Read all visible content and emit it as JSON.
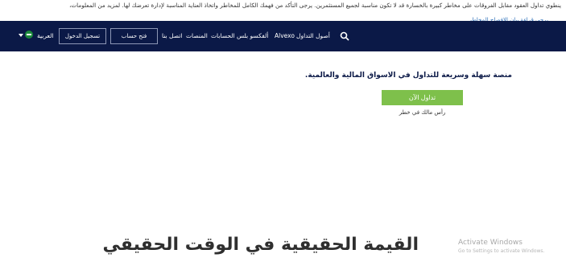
{
  "risk_banner": {
    "text": "ينطوي تداول العقود مقابل الفروقات على مخاطر كبيرة بالخسارة قد لا تكون مناسبة لجميع المستثمرين. يرجى التأكد من فهمك الكامل للمخاطر واتخاذ العناية المناسبة لإدارة تعرضك لها. لمزيد من المعلومات،",
    "link": "يرجى قراءة بيان الإفصاح المخاطر"
  },
  "navbar": {
    "items": {
      "trading_assets": "أصول التداول",
      "alvexo": "Alvexo",
      "alvexo_plus": "ألفكسو بلس",
      "accounts": "الحسابات",
      "platforms": "المنصات",
      "contact": "اتصل بنا"
    },
    "open_account": "فتح حساب",
    "login": "تسجيل الدخول",
    "language": "العربية"
  },
  "hero": {
    "headline": "منصة سهلة وسريعة للتداول في الاسواق المالية والعالمية.",
    "cta": "تداول الآن",
    "risk_note": "رأس مالك في خطر"
  },
  "section": {
    "heading": "القيمة الحقيقية في الوقت الحقيقي"
  },
  "windows_watermark": {
    "title": "Activate Windows",
    "subtitle": "Go to Settings to activate Windows."
  }
}
